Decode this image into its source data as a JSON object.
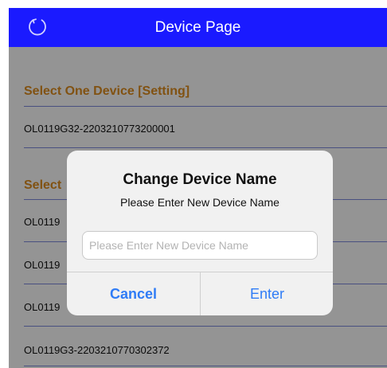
{
  "navbar": {
    "title": "Device Page",
    "refresh_icon": "refresh-icon"
  },
  "section1": {
    "header": "Select One Device [Setting]",
    "devices": [
      "OL0119G32-2203210773200001"
    ]
  },
  "section2": {
    "header_visible": "Select",
    "devices_visible": [
      "OL0119",
      "OL0119",
      "OL0119",
      "OL0119G3-2203210770302372"
    ]
  },
  "dialog": {
    "title": "Change Device Name",
    "message": "Please Enter New Device Name",
    "input_placeholder": "Please Enter New Device Name",
    "input_value": "",
    "cancel_label": "Cancel",
    "enter_label": "Enter"
  },
  "colors": {
    "navbar": "#1a1aff",
    "section_header": "#d8891e",
    "separator": "#7b86d6",
    "dialog_button": "#2f7cf6"
  }
}
